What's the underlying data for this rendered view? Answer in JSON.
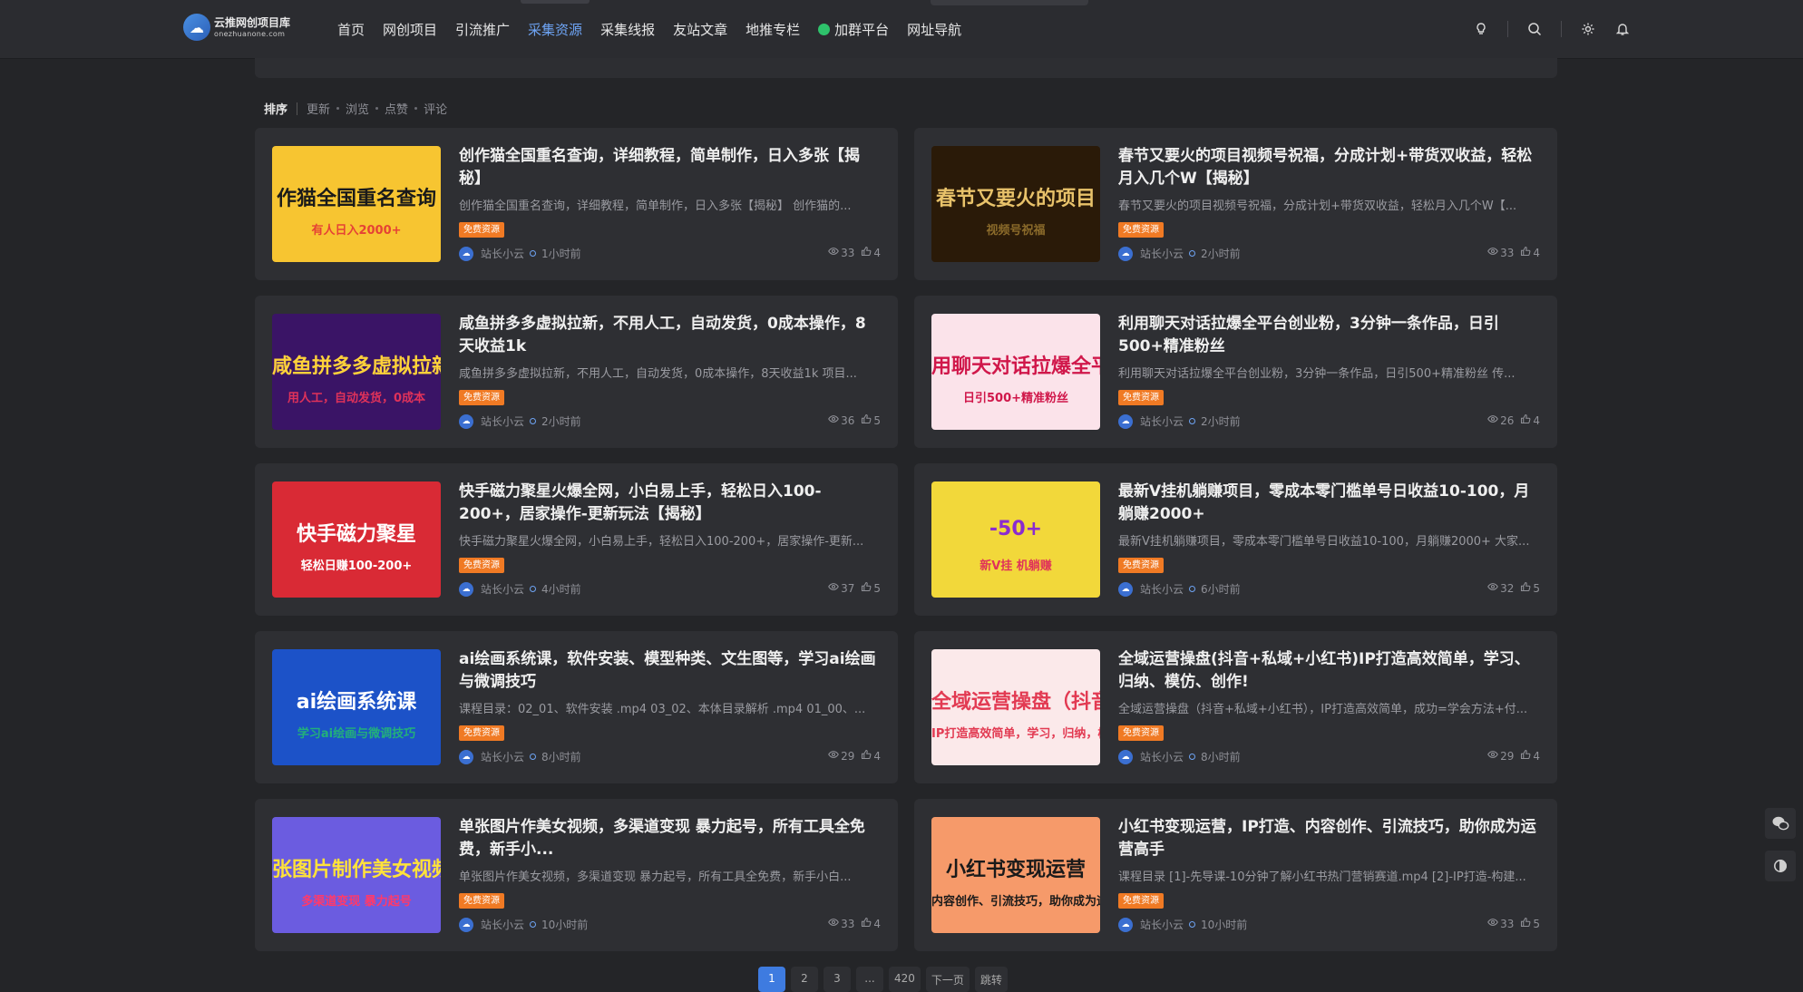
{
  "brand": {
    "name": "云推网创项目库",
    "domain": "onezhuanone.com"
  },
  "nav": {
    "items": [
      {
        "label": "首页"
      },
      {
        "label": "网创项目"
      },
      {
        "label": "引流推广"
      },
      {
        "label": "采集资源",
        "active": true
      },
      {
        "label": "采集线报"
      },
      {
        "label": "友站文章"
      },
      {
        "label": "地推专栏"
      },
      {
        "label": "加群平台",
        "dot": true
      },
      {
        "label": "网址导航"
      }
    ]
  },
  "sort": {
    "label": "排序",
    "options": [
      "更新",
      "浏览",
      "点赞",
      "评论"
    ]
  },
  "cards": [
    {
      "title": "创作猫全国重名查询，详细教程，简单制作，日入多张【揭秘】",
      "desc": "创作猫全国重名查询，详细教程，简单制作，日入多张【揭秘】 创作猫的...",
      "badge": "免费资源",
      "author": "站长小云",
      "time": "1小时前",
      "views": "33",
      "likes": "4",
      "thumb": {
        "bg": "#f7c531",
        "line1": "作猫全国重名查询",
        "line2": "有人日入2000+",
        "fg": "#1a1a1a",
        "accent": "#e54235"
      }
    },
    {
      "title": "春节又要火的项目视频号祝福，分成计划+带货双收益，轻松月入几个W【揭秘】",
      "desc": "春节又要火的项目视频号祝福，分成计划+带货双收益，轻松月入几个W【...",
      "badge": "免费资源",
      "author": "站长小云",
      "time": "2小时前",
      "views": "33",
      "likes": "4",
      "thumb": {
        "bg": "#2a1a08",
        "line1": "春节又要火的项目",
        "line2": "视频号祝福",
        "fg": "#e8c26a",
        "accent": "#8a6a2a"
      }
    },
    {
      "title": "咸鱼拼多多虚拟拉新，不用人工，自动发货，0成本操作，8天收益1k",
      "desc": "咸鱼拼多多虚拟拉新，不用人工，自动发货，0成本操作，8天收益1k 项目...",
      "badge": "免费资源",
      "author": "站长小云",
      "time": "2小时前",
      "views": "36",
      "likes": "5",
      "thumb": {
        "bg": "#3a1466",
        "line1": "咸鱼拼多多虚拟拉新",
        "line2": "用人工，自动发货，0成本",
        "fg": "#ffd23a",
        "accent": "#e0325a"
      }
    },
    {
      "title": "利用聊天对话拉爆全平台创业粉，3分钟一条作品，日引500+精准粉丝",
      "desc": "利用聊天对话拉爆全平台创业粉，3分钟一条作品，日引500+精准粉丝 传...",
      "badge": "免费资源",
      "author": "站长小云",
      "time": "2小时前",
      "views": "26",
      "likes": "4",
      "thumb": {
        "bg": "#fbe3ea",
        "line1": "用聊天对话拉爆全平台创业",
        "line2": "日引500+精准粉丝",
        "fg": "#d0174a",
        "accent": "#d0174a"
      }
    },
    {
      "title": "快手磁力聚星火爆全网，小白易上手，轻松日入100-200+，居家操作-更新玩法【揭秘】",
      "desc": "快手磁力聚星火爆全网，小白易上手，轻松日入100-200+，居家操作-更新...",
      "badge": "免费资源",
      "author": "站长小云",
      "time": "4小时前",
      "views": "37",
      "likes": "5",
      "thumb": {
        "bg": "#d92a35",
        "line1": "快手磁力聚星",
        "line2": "轻松日赚100-200+",
        "fg": "#ffffff",
        "accent": "#ffffff"
      }
    },
    {
      "title": "最新V挂机躺赚项目，零成本零门槛单号日收益10-100，月躺赚2000+",
      "desc": "最新V挂机躺赚项目，零成本零门槛单号日收益10-100，月躺赚2000+ 大家...",
      "badge": "免费资源",
      "author": "站长小云",
      "time": "6小时前",
      "views": "32",
      "likes": "5",
      "thumb": {
        "bg": "#f2d83a",
        "line1": "-50+",
        "line2": "新V挂 机躺赚",
        "fg": "#8a2bd0",
        "accent": "#e0325a"
      }
    },
    {
      "title": "ai绘画系统课，软件安装、模型种类、文生图等，学习ai绘画与微调技巧",
      "desc": "课程目录：02_01、软件安装 .mp4 03_02、本体目录解析 .mp4 01_00、...",
      "badge": "免费资源",
      "author": "站长小云",
      "time": "8小时前",
      "views": "29",
      "likes": "4",
      "thumb": {
        "bg": "#1c52c8",
        "line1": "ai绘画系统课",
        "line2": "学习ai绘画与微调技巧",
        "fg": "#ffffff",
        "accent": "#22b07a"
      }
    },
    {
      "title": "全域运营操盘(抖音+私域+小红书)IP打造高效简单，学习、归纳、模仿、创作!",
      "desc": "全域运营操盘（抖音+私域+小红书），IP打造高效简单，成功=学会方法+付...",
      "badge": "免费资源",
      "author": "站长小云",
      "time": "8小时前",
      "views": "29",
      "likes": "4",
      "thumb": {
        "bg": "#fbe9ea",
        "line1": "全域运营操盘（抖音+私域+小红书）",
        "line2": "IP打造高效简单，学习，归纳，模仿，创作!",
        "fg": "#e23a52",
        "accent": "#e23a52"
      }
    },
    {
      "title": "单张图片作美女视频，多渠道变现 暴力起号，所有工具全免费，新手小...",
      "desc": "单张图片作美女视频，多渠道变现 暴力起号，所有工具全免费，新手小白...",
      "badge": "免费资源",
      "author": "站长小云",
      "time": "10小时前",
      "views": "33",
      "likes": "4",
      "thumb": {
        "bg": "#6b5ce0",
        "line1": "张图片制作美女视频",
        "line2": "多渠道变现 暴力起号",
        "fg": "#ffe23a",
        "accent": "#ff3a6a"
      }
    },
    {
      "title": "小红书变现运营，IP打造、内容创作、引流技巧，助你成为运营高手",
      "desc": "课程目录 [1]-先导课-10分钟了解小红书热门营销赛道.mp4 [2]-IP打造-构建...",
      "badge": "免费资源",
      "author": "站长小云",
      "time": "10小时前",
      "views": "33",
      "likes": "5",
      "thumb": {
        "bg": "#f69a6a",
        "line1": "小红书变现运营",
        "line2": "内容创作、引流技巧，助你成为运营",
        "fg": "#1a1a1a",
        "accent": "#1a1a1a"
      }
    }
  ],
  "pagination": [
    "1",
    "2",
    "3",
    "...",
    "420",
    "下一页",
    "跳转"
  ],
  "float_buttons": [
    {
      "icon": "wechat-icon"
    },
    {
      "icon": "theme-icon"
    }
  ]
}
